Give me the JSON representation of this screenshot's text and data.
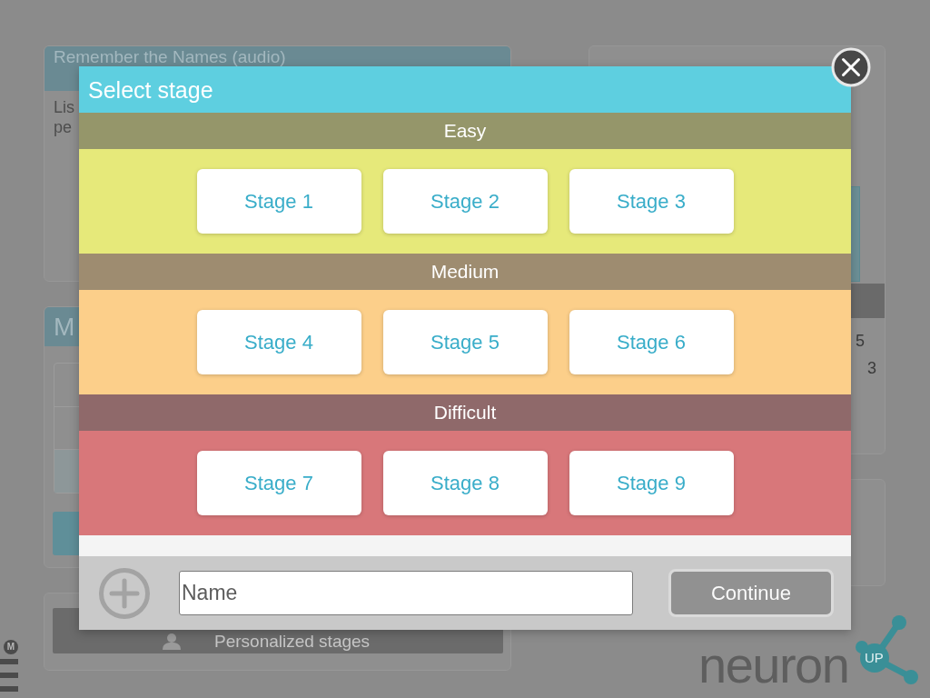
{
  "background": {
    "activity_card": {
      "title": "Remember the Names (audio)",
      "description_lines": [
        "Lis",
        "pe"
      ]
    },
    "list_card": {
      "title": "M"
    },
    "personalized_button": {
      "label": "Personalized stages"
    },
    "side_panel": {
      "lines": [
        "5",
        "3"
      ]
    },
    "menu": {
      "badge": "M"
    },
    "logo": {
      "wordmark": "neuron",
      "badge": "UP"
    }
  },
  "dialog": {
    "title": "Select stage",
    "levels": [
      {
        "name": "Easy",
        "color": "#e6e97a",
        "stages": [
          {
            "label": "Stage 1",
            "selected": false
          },
          {
            "label": "Stage 2",
            "selected": false
          },
          {
            "label": "Stage 3",
            "selected": false
          }
        ]
      },
      {
        "name": "Medium",
        "color": "#fccf8a",
        "stages": [
          {
            "label": "Stage 4",
            "selected": false
          },
          {
            "label": "Stage 5",
            "selected": false
          },
          {
            "label": "Stage 6",
            "selected": false
          }
        ]
      },
      {
        "name": "Difficult",
        "color": "#d8777a",
        "stages": [
          {
            "label": "Stage 7",
            "selected": false
          },
          {
            "label": "Stage 8",
            "selected": false
          },
          {
            "label": "Stage 9",
            "selected": false
          }
        ]
      }
    ],
    "name_field": {
      "placeholder": "Name"
    },
    "continue_button": {
      "label": "Continue",
      "disabled": true
    }
  }
}
